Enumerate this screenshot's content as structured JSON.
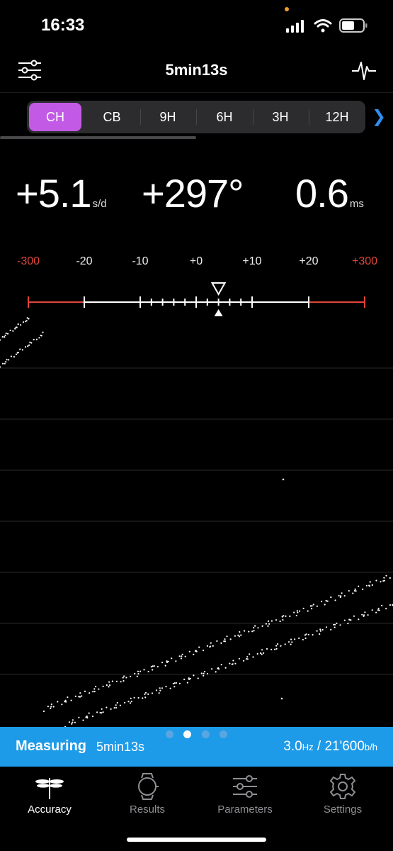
{
  "status_bar": {
    "time": "16:33",
    "icons": [
      "cellular-signal-icon",
      "wifi-icon",
      "battery-icon"
    ]
  },
  "header": {
    "title": "5min13s",
    "left_icon": "sliders-icon",
    "right_icon": "waveform-icon"
  },
  "positions": {
    "items": [
      "CH",
      "CB",
      "9H",
      "6H",
      "3H",
      "12H"
    ],
    "selected": "CH",
    "more_icon": "chevron-right-icon"
  },
  "readouts": {
    "rate": {
      "value": "+5.1",
      "unit": "s/d"
    },
    "amplitude": {
      "value": "+297°"
    },
    "beat_error": {
      "value": "0.6",
      "unit": "ms"
    }
  },
  "scale": {
    "labels": [
      "-300",
      "-20",
      "-10",
      "+0",
      "+10",
      "+20",
      "+300"
    ],
    "pointer_value": 4,
    "range_red": "#e0453a"
  },
  "banner": {
    "state": "Measuring",
    "duration": "5min13s",
    "frequency_value": "3.0",
    "frequency_unit": "Hz",
    "separator": "/",
    "beats_value": "21'600",
    "beats_unit": "b/h"
  },
  "page_dots": {
    "count": 4,
    "active_index": 1
  },
  "tabs": [
    {
      "label": "Accuracy",
      "icon": "dragonfly-icon",
      "active": true
    },
    {
      "label": "Results",
      "icon": "watch-icon",
      "active": false
    },
    {
      "label": "Parameters",
      "icon": "sliders-icon",
      "active": false
    },
    {
      "label": "Settings",
      "icon": "gear-icon",
      "active": false
    }
  ],
  "colors": {
    "accent": "#c35ae6",
    "banner": "#1e9be8",
    "link": "#2f8ef0"
  }
}
